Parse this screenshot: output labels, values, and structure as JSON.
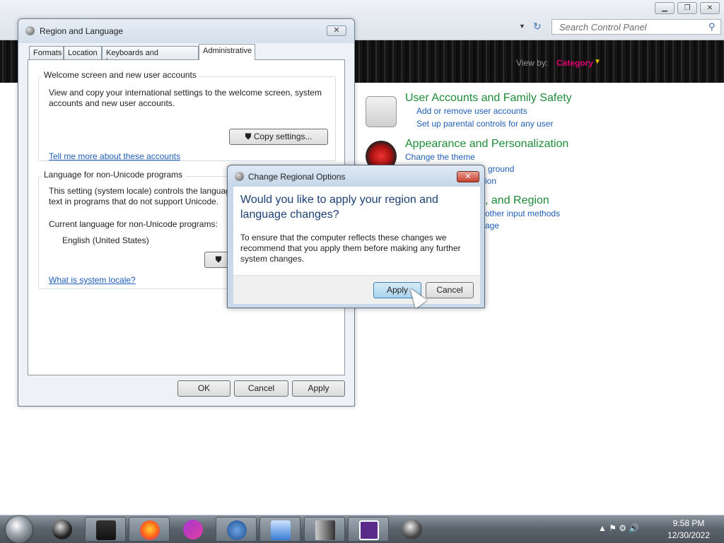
{
  "control_panel": {
    "search_placeholder": "Search Control Panel",
    "view_by_label": "View by:",
    "view_by_value": "Category",
    "categories": [
      {
        "title": "User Accounts and Family Safety",
        "links": [
          "Add or remove user accounts",
          "Set up parental controls for any user"
        ]
      },
      {
        "title": "Appearance and Personalization",
        "links": [
          "Change the theme",
          "ground",
          "ion"
        ]
      },
      {
        "title": ", and Region",
        "links": [
          "other input methods",
          "age"
        ]
      }
    ]
  },
  "region_language": {
    "title": "Region and Language",
    "tabs": [
      "Formats",
      "Location",
      "Keyboards and Languages",
      "Administrative"
    ],
    "welcome_group": {
      "label": "Welcome screen and new user accounts",
      "description": "View and copy your international settings to the welcome screen, system accounts and new user accounts.",
      "copy_button": "Copy settings...",
      "link": "Tell me more about these accounts"
    },
    "unicode_group": {
      "label": "Language for non-Unicode programs",
      "description": "This setting (system locale) controls the languag text in programs that do not support Unicode.",
      "current_label": "Current language for non-Unicode programs:",
      "current_value": "English (United States)",
      "link": "What is system locale?"
    },
    "buttons": {
      "ok": "OK",
      "cancel": "Cancel",
      "apply": "Apply"
    }
  },
  "dialog": {
    "title": "Change Regional Options",
    "heading": "Would you like to apply your region and language changes?",
    "message": "To ensure that the computer reflects these changes we recommend that you apply them before making any further system changes.",
    "apply": "Apply",
    "cancel": "Cancel"
  },
  "taskbar": {
    "apps": [
      "app-1",
      "app-2",
      "firefox",
      "app-4",
      "app-5",
      "app-6",
      "app-7",
      "app-8",
      "app-9"
    ],
    "time": "9:58 PM",
    "date": "12/30/2022"
  }
}
